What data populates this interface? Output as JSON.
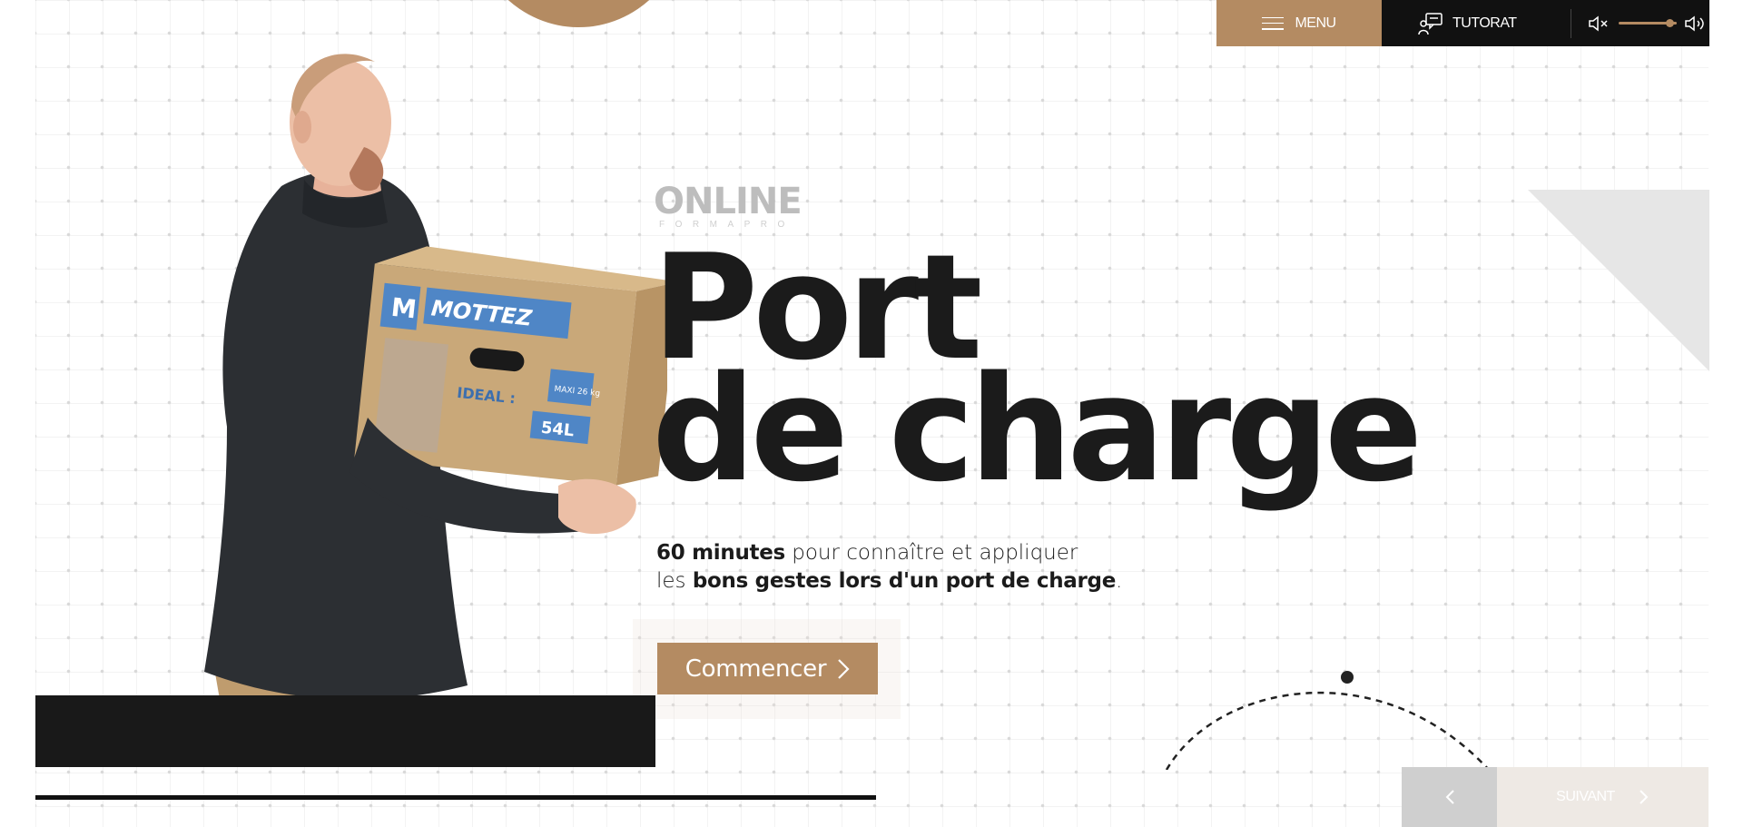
{
  "topbar": {
    "menu_label": "MENU",
    "tutorat_label": "TUTORAT",
    "volume_level": 0.88
  },
  "logo": {
    "word": "ONLINE",
    "sub": "FORMAPRO"
  },
  "hero": {
    "title_line1": "Port",
    "title_line2": "de charge",
    "subtitle_line1_bold": "60 minutes",
    "subtitle_line1_rest": " pour connaître et appliquer",
    "subtitle_line2_start": "les ",
    "subtitle_line2_bold": "bons gestes lors d'un port de charge",
    "subtitle_line2_end": "."
  },
  "cta": {
    "label": "Commencer",
    "icon": "chevron-right-icon"
  },
  "illustration": {
    "box_brand": "MOTTEZ",
    "box_text": "IDEAL :",
    "box_capacity": "54L",
    "box_label": "MAXI 26 kg"
  },
  "nav": {
    "prev_icon": "chevron-left-icon",
    "next_label": "SUIVANT",
    "next_icon": "chevron-right-icon"
  },
  "colors": {
    "accent": "#b48b62",
    "dark": "#111111",
    "text": "#1b1b1b"
  }
}
